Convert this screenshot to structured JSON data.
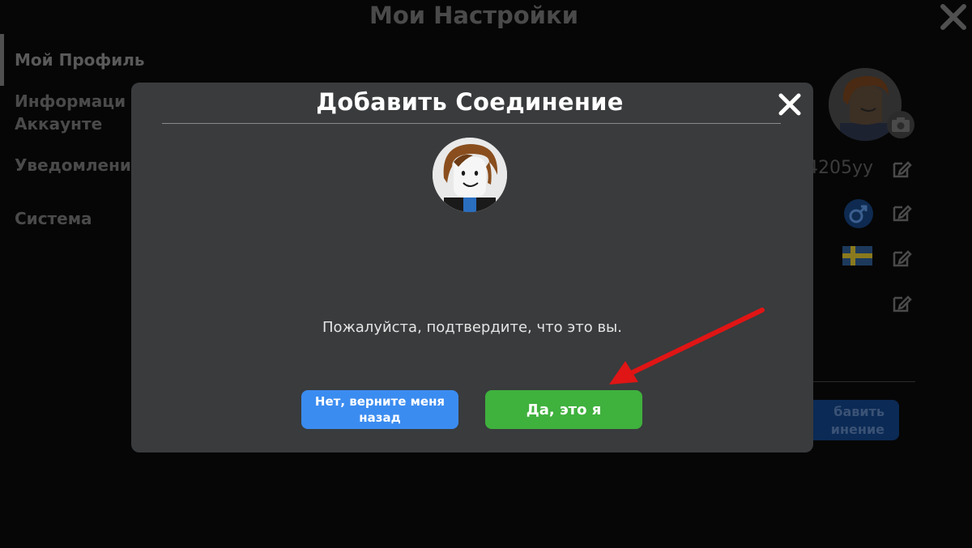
{
  "background": {
    "title": "Мои Настройки",
    "sidebar": [
      {
        "label": "Мой Профиль",
        "active": true
      },
      {
        "label": "Информаци\nАккаунте"
      },
      {
        "label": "Уведомлени"
      },
      {
        "label": "Система"
      }
    ],
    "username_fragment": "4205yy",
    "connect_button_fragment": "бавить\nинение"
  },
  "modal": {
    "title": "Добавить Соединение",
    "message": "Пожалуйста, подтвердите, что это вы.",
    "no_button": "Нет, верните меня назад",
    "yes_button": "Да, это я"
  },
  "icons": {
    "close": "close-icon",
    "camera": "camera-icon",
    "edit": "edit-icon",
    "gender": "male-symbol-icon",
    "flag": "sweden-flag-icon"
  },
  "colors": {
    "modal_bg": "#393b3d",
    "no_button": "#3b8cf0",
    "yes_button": "#3fb13d",
    "arrow": "#e01515"
  }
}
